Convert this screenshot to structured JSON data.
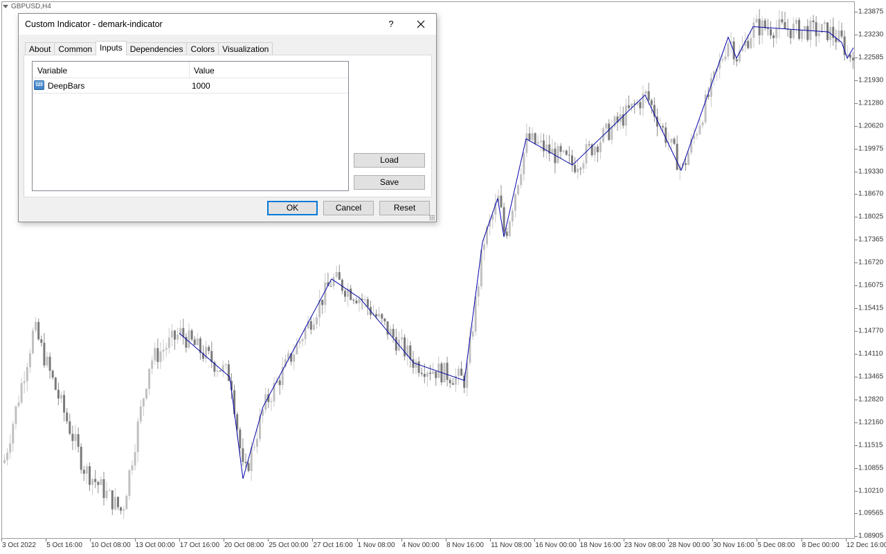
{
  "chart": {
    "symbol": "GBPUSD,H4",
    "background": "#ffffff",
    "candle_color": "#c0c0c0",
    "indicator_color": "#0000aa",
    "price_labels": [
      "1.23875",
      "1.23230",
      "1.22585",
      "1.21930",
      "1.21280",
      "1.20620",
      "1.19975",
      "1.19330",
      "1.18670",
      "1.18025",
      "1.17365",
      "1.16720",
      "1.16075",
      "1.15415",
      "1.14770",
      "1.14110",
      "1.13465",
      "1.12820",
      "1.12160",
      "1.11515",
      "1.10855",
      "1.10210",
      "1.09565",
      "1.08905"
    ],
    "time_labels": [
      "3 Oct 2022",
      "5 Oct 16:00",
      "10 Oct 08:00",
      "13 Oct 00:00",
      "17 Oct 16:00",
      "20 Oct 08:00",
      "25 Oct 00:00",
      "27 Oct 16:00",
      "1 Nov 08:00",
      "4 Nov 00:00",
      "8 Nov 16:00",
      "11 Nov 08:00",
      "16 Nov 00:00",
      "18 Nov 16:00",
      "23 Nov 08:00",
      "28 Nov 00:00",
      "30 Nov 16:00",
      "5 Dec 08:00",
      "8 Dec 00:00",
      "12 Dec 16:00"
    ],
    "zigzag": [
      {
        "time": "17 Oct",
        "price": 1.147
      },
      {
        "time": "20 Oct",
        "price": 1.1345
      },
      {
        "time": "20 Oct",
        "price": 1.1055
      },
      {
        "time": "24 Oct",
        "price": 1.126
      },
      {
        "time": "27 Oct",
        "price": 1.1625
      },
      {
        "time": "31 Oct",
        "price": 1.157
      },
      {
        "time": "4 Nov",
        "price": 1.1385
      },
      {
        "time": "8 Nov",
        "price": 1.1335
      },
      {
        "time": "10 Nov",
        "price": 1.173
      },
      {
        "time": "11 Nov",
        "price": 1.1855
      },
      {
        "time": "11 Nov",
        "price": 1.1745
      },
      {
        "time": "15 Nov",
        "price": 1.2025
      },
      {
        "time": "18 Nov",
        "price": 1.195
      },
      {
        "time": "23 Nov",
        "price": 1.215
      },
      {
        "time": "28 Nov",
        "price": 1.1935
      },
      {
        "time": "1 Dec",
        "price": 1.2315
      },
      {
        "time": "2 Dec",
        "price": 1.2255
      },
      {
        "time": "5 Dec",
        "price": 1.2345
      },
      {
        "time": "8 Dec",
        "price": 1.233
      },
      {
        "time": "12 Dec",
        "price": 1.23
      },
      {
        "time": "12 Dec",
        "price": 1.2255
      },
      {
        "time": "12 Dec",
        "price": 1.2285
      }
    ]
  },
  "dialog": {
    "title": "Custom Indicator - demark-indicator",
    "help_label": "?",
    "tabs": [
      {
        "label": "About"
      },
      {
        "label": "Common"
      },
      {
        "label": "Inputs"
      },
      {
        "label": "Dependencies"
      },
      {
        "label": "Colors"
      },
      {
        "label": "Visualization"
      }
    ],
    "active_tab": "Inputs",
    "table": {
      "col_variable": "Variable",
      "col_value": "Value",
      "row": {
        "icon": "number-icon",
        "icon_text": "123",
        "name": "DeepBars",
        "value": "1000"
      }
    },
    "buttons": {
      "load": "Load",
      "save": "Save",
      "ok": "OK",
      "cancel": "Cancel",
      "reset": "Reset"
    }
  }
}
